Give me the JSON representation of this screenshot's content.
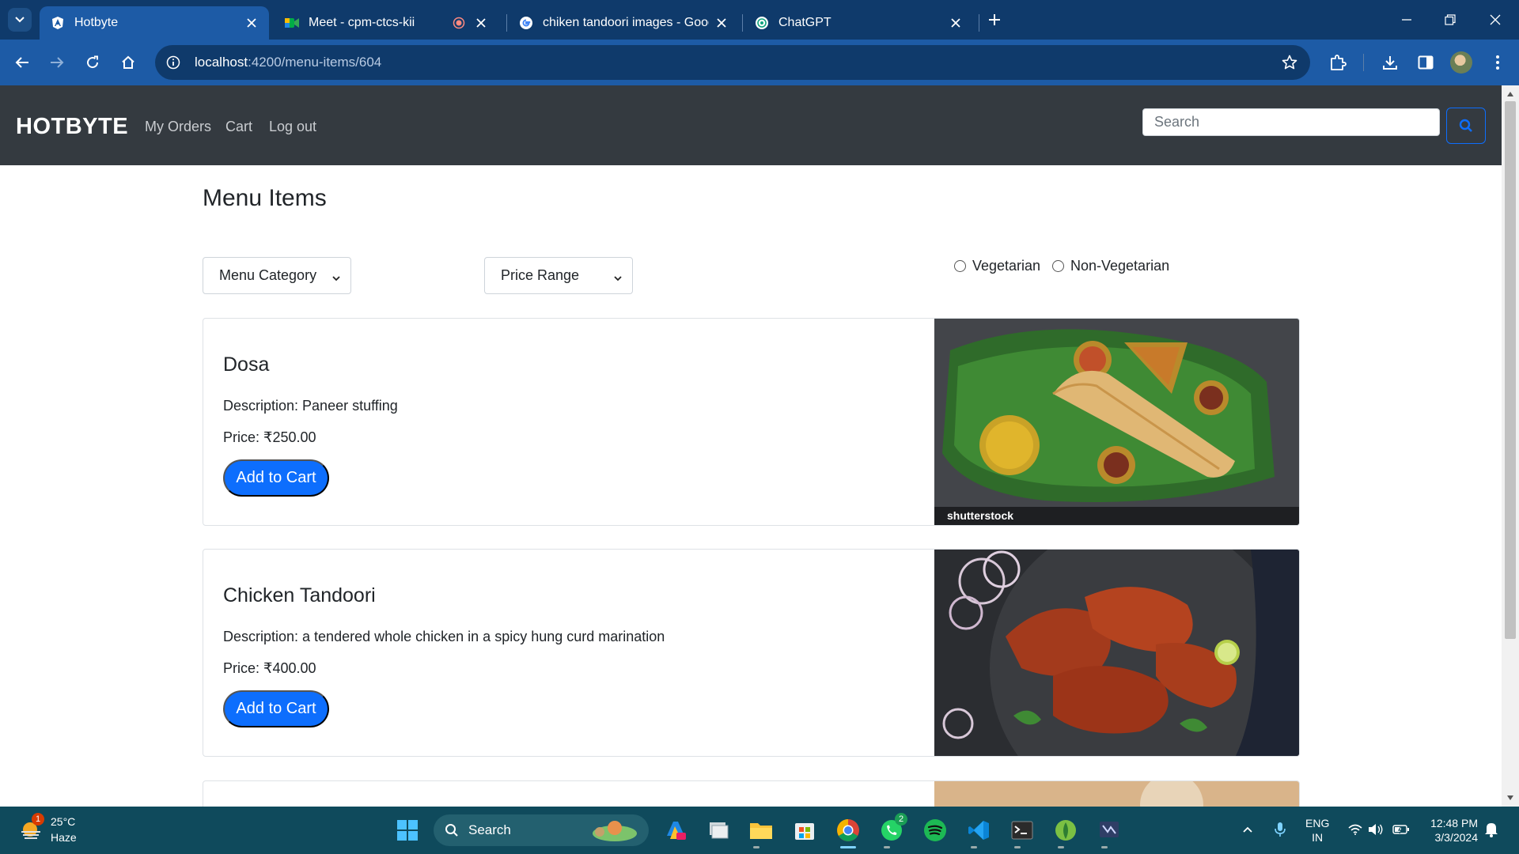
{
  "browser": {
    "tabs": [
      {
        "title": "Hotbyte",
        "favicon": "angular-icon",
        "active": true
      },
      {
        "title": "Meet - cpm-ctcs-kii",
        "favicon": "google-meet-icon",
        "active": false
      },
      {
        "title": "chiken tandoori images - Googl",
        "favicon": "google-icon",
        "active": false
      },
      {
        "title": "ChatGPT",
        "favicon": "chatgpt-icon",
        "active": false
      }
    ],
    "url_host": "localhost",
    "url_path": ":4200/menu-items/604"
  },
  "navbar": {
    "brand": "HOTBYTE",
    "links": [
      "My Orders",
      "Cart",
      "Log out"
    ],
    "search_placeholder": "Search"
  },
  "page": {
    "title": "Menu Items",
    "filters": {
      "category": "Menu Category",
      "price": "Price Range",
      "diet_options": [
        "Vegetarian",
        "Non-Vegetarian"
      ]
    },
    "items": [
      {
        "name": "Dosa",
        "description": "Description: Paneer stuffing",
        "price": "Price: ₹250.00",
        "button": "Add to Cart",
        "image_watermark": "shutterstock"
      },
      {
        "name": "Chicken Tandoori",
        "description": "Description: a tendered whole chicken in a spicy hung curd marination",
        "price": "Price: ₹400.00",
        "button": "Add to Cart"
      }
    ]
  },
  "taskbar": {
    "weather": {
      "temp": "25°C",
      "condition": "Haze",
      "alert_count": "1"
    },
    "search_label": "Search",
    "whatsapp_badge": "2",
    "lang_line1": "ENG",
    "lang_line2": "IN",
    "time": "12:48 PM",
    "date": "3/3/2024"
  },
  "colors": {
    "tabstrip": "#0f3a6b",
    "toolbar": "#1d5ba6",
    "navbar": "#343a40",
    "primary": "#0d6efd",
    "taskbar": "#0f4a5c"
  }
}
